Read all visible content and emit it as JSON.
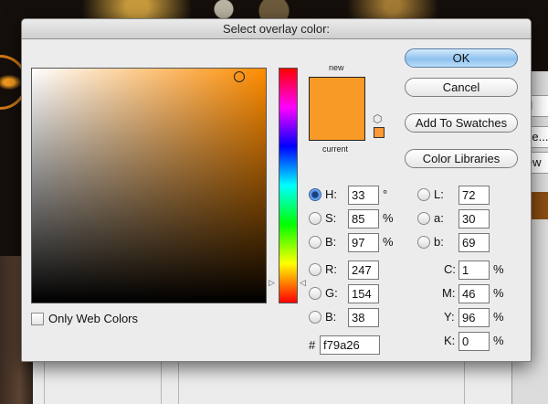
{
  "dialog": {
    "title": "Select overlay color:",
    "swatch_new_label": "new",
    "swatch_current_label": "current",
    "new_color": "#f79a26",
    "current_color": "#f79a26",
    "hue_color": "#ff8c00",
    "web_safe_color": "#ff9933",
    "field_marker_icon": "circle-marker-icon",
    "buttons": {
      "ok": "OK",
      "cancel": "Cancel",
      "add_to_swatches": "Add To Swatches",
      "color_libraries": "Color Libraries"
    },
    "only_web_colors": {
      "label": "Only Web Colors",
      "checked": false
    },
    "hsb": {
      "h": {
        "label": "H:",
        "value": "33",
        "unit": "°",
        "selected": true
      },
      "s": {
        "label": "S:",
        "value": "85",
        "unit": "%",
        "selected": false
      },
      "b": {
        "label": "B:",
        "value": "97",
        "unit": "%",
        "selected": false
      }
    },
    "rgb": {
      "r": {
        "label": "R:",
        "value": "247"
      },
      "g": {
        "label": "G:",
        "value": "154"
      },
      "b": {
        "label": "B:",
        "value": "38"
      }
    },
    "lab": {
      "l": {
        "label": "L:",
        "value": "72"
      },
      "a": {
        "label": "a:",
        "value": "30"
      },
      "b": {
        "label": "b:",
        "value": "69"
      }
    },
    "cmyk": {
      "c": {
        "label": "C:",
        "value": "1",
        "unit": "%"
      },
      "m": {
        "label": "M:",
        "value": "46",
        "unit": "%"
      },
      "y": {
        "label": "Y:",
        "value": "96",
        "unit": "%"
      },
      "k": {
        "label": "K:",
        "value": "0",
        "unit": "%"
      }
    },
    "hex": {
      "label": "#",
      "value": "f79a26"
    }
  },
  "background_app": {
    "fields": [
      "el",
      "yle...",
      "iew"
    ]
  }
}
